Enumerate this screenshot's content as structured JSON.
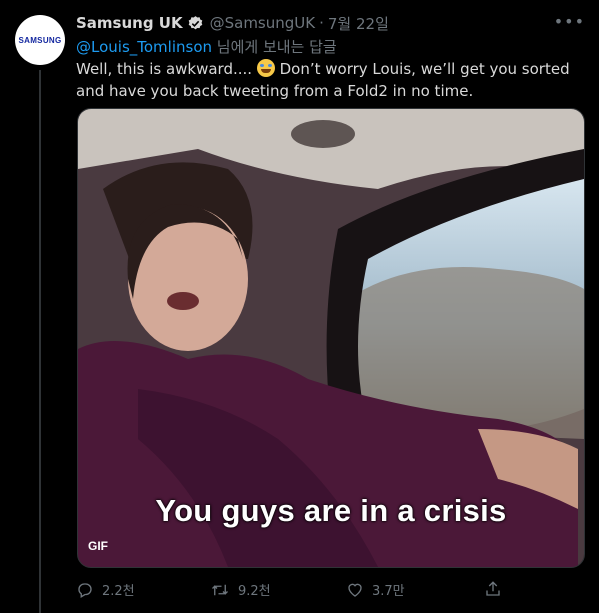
{
  "tweet": {
    "author_name": "Samsung UK",
    "handle": "@SamsungUK",
    "separator": "·",
    "date": "7월 22일",
    "avatar_text": "SAMSUNG",
    "reply_to_mention": "@Louis_Tomlinson",
    "reply_to_suffix": " 님에게 보내는 답글",
    "text_before_emoji": "Well, this is awkward.... ",
    "text_after_emoji": " Don’t worry Louis, we’ll get you sorted and have you back tweeting from a Fold2 in no time."
  },
  "media": {
    "badge": "GIF",
    "caption": "You guys are in a crisis"
  },
  "actions": {
    "replies": "2.2천",
    "retweets": "9.2천",
    "likes": "3.7만"
  },
  "colors": {
    "background": "#000000",
    "text": "#d9d9d9",
    "muted": "#6e767d",
    "link": "#1d9bf0"
  }
}
